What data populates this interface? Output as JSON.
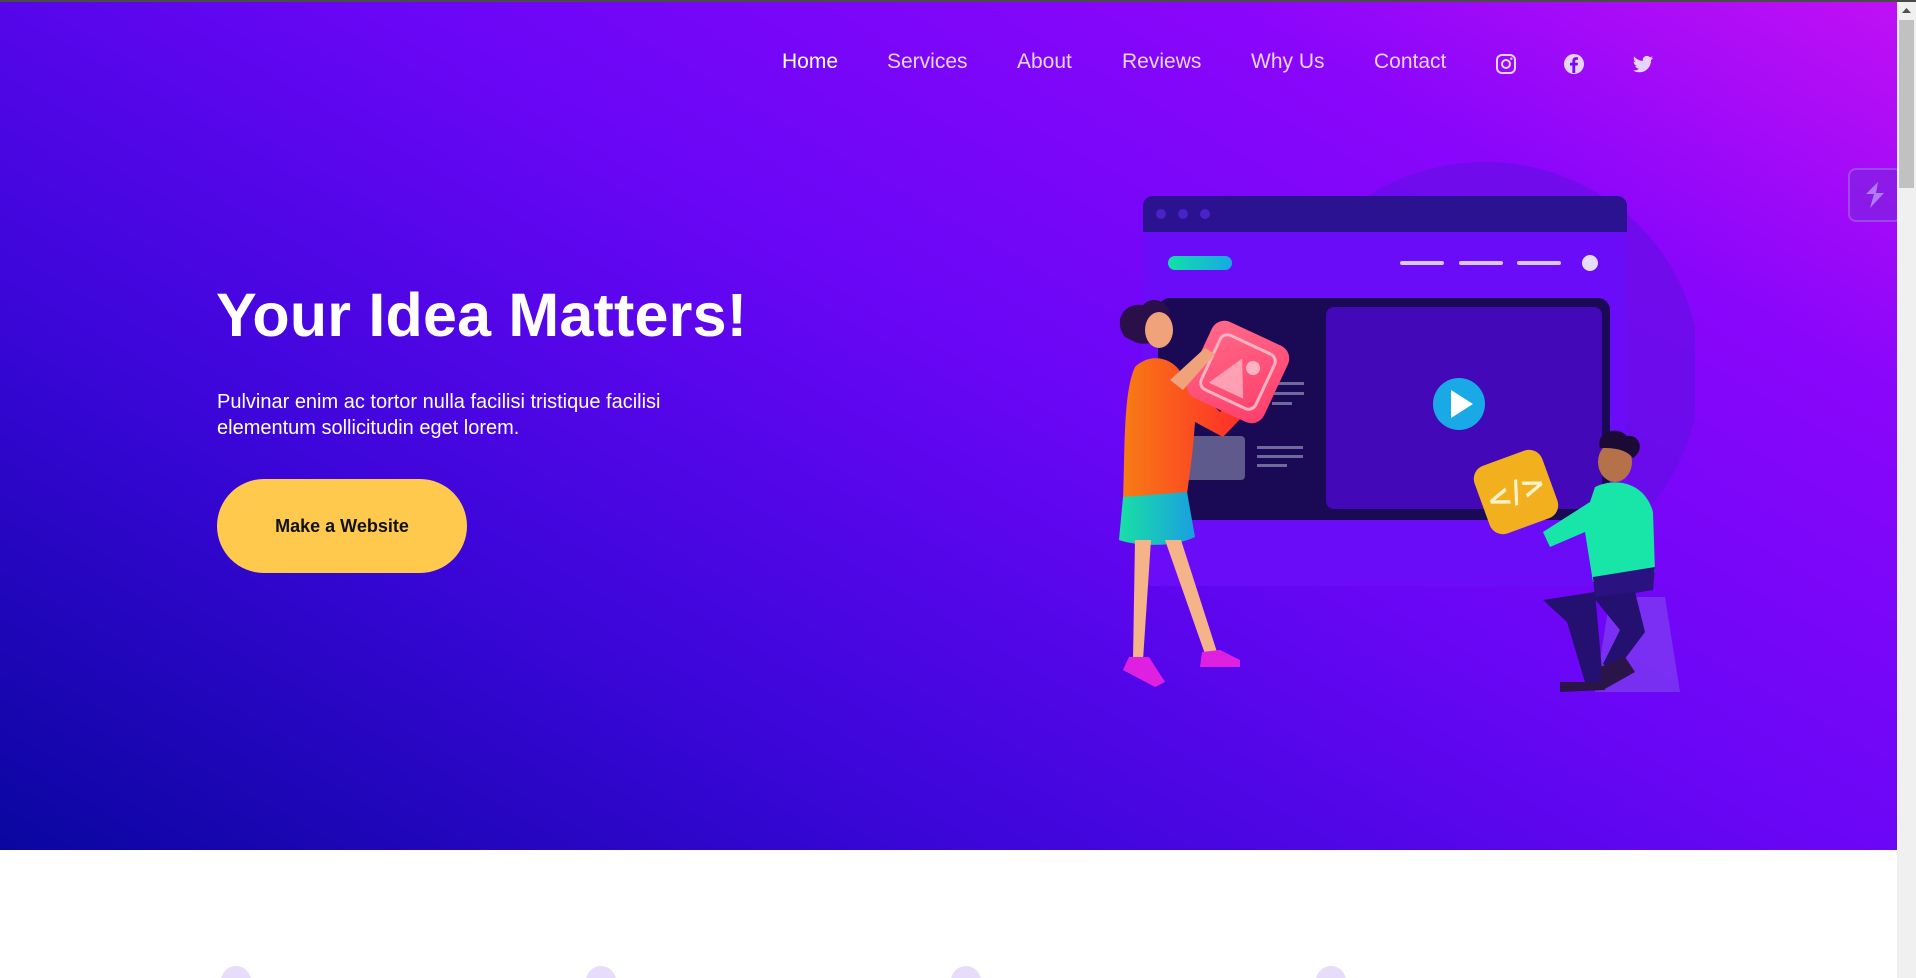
{
  "nav": {
    "links": [
      {
        "label": "Home",
        "active": true
      },
      {
        "label": "Services"
      },
      {
        "label": "About"
      },
      {
        "label": "Reviews"
      },
      {
        "label": "Why Us"
      },
      {
        "label": "Contact"
      }
    ],
    "social_icons": [
      "instagram-icon",
      "facebook-icon",
      "twitter-icon"
    ]
  },
  "hero": {
    "title": "Your Idea Matters!",
    "subtitle": "Pulvinar enim ac tortor nulla facilisi tristique facilisi elementum sollicitudin eget lorem.",
    "cta_label": "Make a Website"
  },
  "colors": {
    "hero_gradient_start": "#0a06a0",
    "hero_gradient_end": "#c010f4",
    "cta_background": "#ffc94d",
    "nav_link": "#e6d4ff"
  },
  "floating_widget_icon": "lightning-icon"
}
